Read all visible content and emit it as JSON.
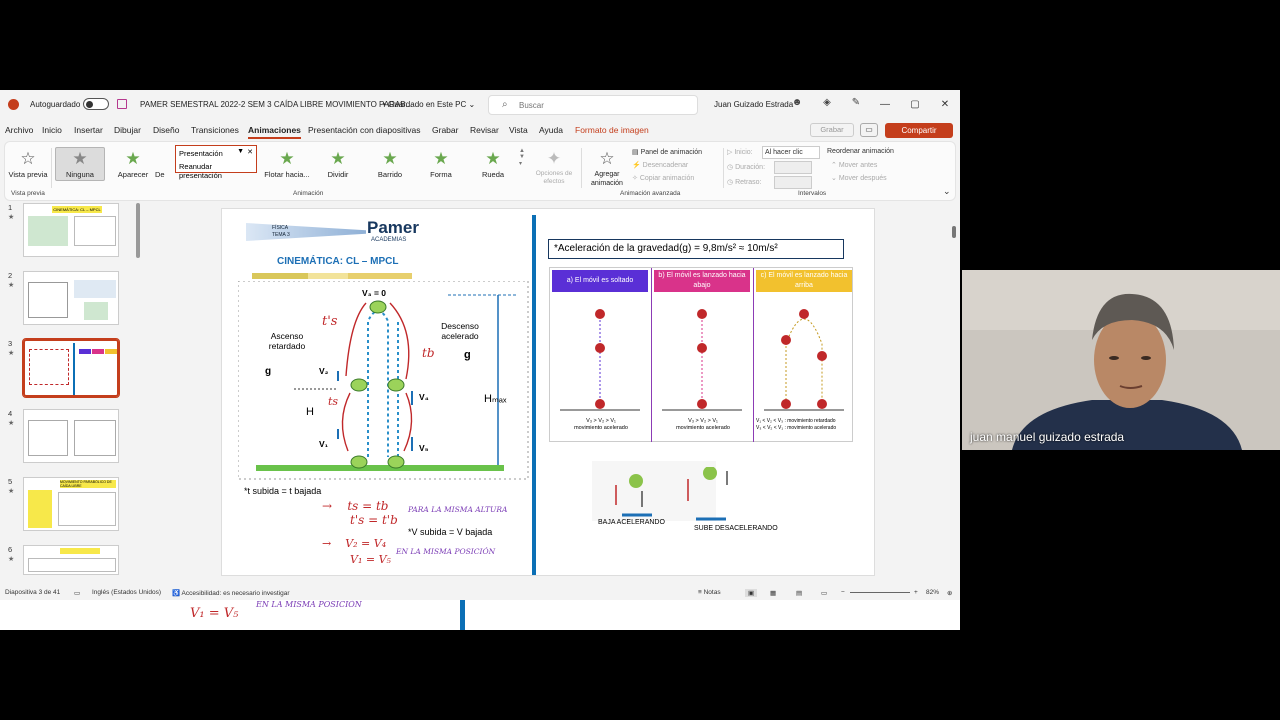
{
  "window": {
    "autosave_label": "Autoguardado",
    "doc_title": "PAMER SEMESTRAL 2022-2  SEM 3 CAÍDA LIBRE MOVIMIENTO PARAB...",
    "save_status": "• Guardado en Este PC ⌄",
    "search_placeholder": "Buscar",
    "user_name": "Juan Guizado Estrada"
  },
  "menu": {
    "tabs": [
      "Archivo",
      "Inicio",
      "Insertar",
      "Dibujar",
      "Diseño",
      "Transiciones",
      "Animaciones",
      "Presentación con diapositivas",
      "Grabar",
      "Revisar",
      "Vista",
      "Ayuda",
      "Formato de imagen"
    ],
    "grabar": "Grabar",
    "share": "Compartir"
  },
  "ribbon": {
    "preview": "Vista previa",
    "preview_group": "Vista previa",
    "animations": [
      "Ninguna",
      "Aparecer",
      "De",
      "Flotar hacia...",
      "Dividir",
      "Barrido",
      "Forma",
      "Rueda"
    ],
    "popup_line1": "Presentación",
    "popup_line2": "Reanudar presentación",
    "effect_options": "Opciones de efectos",
    "animation_group": "Animación",
    "add_animation": "Agregar animación",
    "animation_panel": "Panel de animación",
    "trigger": "Desencadenar",
    "copy_animation": "Copiar animación",
    "advanced_group": "Animación avanzada",
    "start_label": "Inicio:",
    "start_value": "Al hacer clic",
    "duration_label": "Duración:",
    "delay_label": "Retraso:",
    "reorder": "Reordenar animación",
    "move_earlier": "Mover antes",
    "move_later": "Mover después",
    "timing_group": "Intervalos"
  },
  "thumbnails": [
    {
      "num": "1",
      "title": "CINEMÁTICA: CL – MPCL"
    },
    {
      "num": "2",
      "title": ""
    },
    {
      "num": "3",
      "title": ""
    },
    {
      "num": "4",
      "title": ""
    },
    {
      "num": "5",
      "title": "MOVIMIENTO PARABÓLICO DE CAÍDA LIBRE"
    },
    {
      "num": "6",
      "title": ""
    }
  ],
  "slide": {
    "subject": "FÍSICA",
    "topic": "TEMA 3",
    "brand": "Pamer",
    "brand_sub": "ACADEMIAS",
    "title": "CINEMÁTICA: CL – MPCL",
    "label_ascenso": "Ascenso retardado",
    "label_descenso": "Descenso acelerado",
    "g": "g",
    "v3": "V₃ = 0",
    "v2": "V₂",
    "v1": "V₁",
    "v4": "V₄",
    "v5": "V₅",
    "H": "H",
    "Hmax": "Hₘₐₓ",
    "ts_hw": "t's",
    "tb_hw": "tb",
    "ts2_hw": "ts",
    "t_rule": "*t subida = t bajada",
    "v_rule": "*V subida = V bajada",
    "hw_eq1": "ts = tb",
    "hw_eq2": "t's = t'b",
    "hw_eq3": "V₂ = V₄",
    "hw_eq4": "V₁ = V₅",
    "hw_note1": "PARA LA MISMA ALTURA",
    "hw_note2": "EN LA MISMA POSICIÓN",
    "gravity": "*Aceleración de la gravedad(g)  = 9,8m/s² ≈ 10m/s²",
    "cases": [
      {
        "label": "a) El móvil es soltado",
        "color": "#5a2fd6",
        "note": "V₃ > V₂ > V₁\nmovimiento acelerado"
      },
      {
        "label": "b) El móvil es lanzado hacia abajo",
        "color": "#d9338a",
        "note": "V₃ > V₂ > V₁\nmovimiento acelerado"
      },
      {
        "label": "c) El móvil es lanzado hacia arriba",
        "color": "#f2c12e",
        "note": "V₁ < V₂ < V₃ : movimiento retardado\nV₃ < V₂ < V₁ : movimiento acelerado"
      }
    ],
    "baja": "BAJA ACELERANDO",
    "sube": "SUBE DESACELERANDO"
  },
  "status": {
    "slide_count": "Diapositiva 3 de 41",
    "language": "Inglés (Estados Unidos)",
    "accessibility": "Accesibilidad: es necesario investigar",
    "notes": "Notas",
    "zoom": "82%"
  },
  "webcam": {
    "participant": "juan manuel guizado estrada"
  }
}
